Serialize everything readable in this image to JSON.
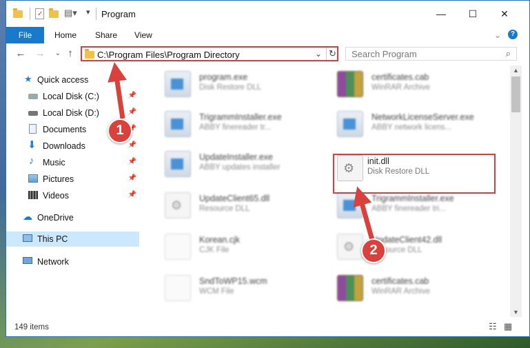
{
  "window": {
    "title": "Program"
  },
  "ribbon": {
    "tabs": [
      "File",
      "Home",
      "Share",
      "View"
    ]
  },
  "address": {
    "path": "C:\\Program Files\\Program Directory"
  },
  "search": {
    "placeholder": "Search Program"
  },
  "sidebar": {
    "items": [
      {
        "label": "Quick access"
      },
      {
        "label": "Local Disk (C:)"
      },
      {
        "label": "Local Disk (D:)"
      },
      {
        "label": "Documents"
      },
      {
        "label": "Downloads"
      },
      {
        "label": "Music"
      },
      {
        "label": "Pictures"
      },
      {
        "label": "Videos"
      },
      {
        "label": "OneDrive"
      },
      {
        "label": "This PC"
      },
      {
        "label": "Network"
      }
    ]
  },
  "files": [
    {
      "name": "program.exe",
      "desc": "Disk Restore DLL"
    },
    {
      "name": "certificates.cab",
      "desc": "WinRAR Archive"
    },
    {
      "name": "TrigrammInstaller.exe",
      "desc": "ABBY finereader tr..."
    },
    {
      "name": "NetworkLicenseServer.exe",
      "desc": "ABBY network licens..."
    },
    {
      "name": "UpdateInstaller.exe",
      "desc": "ABBY updates installer"
    },
    {
      "name": "init.dll",
      "desc": "Disk Restore DLL"
    },
    {
      "name": "UpdateClient65.dll",
      "desc": "Resource DLL"
    },
    {
      "name": "TrigrammInstaller.exe",
      "desc": "ABBY finereader tri..."
    },
    {
      "name": "Korean.cjk",
      "desc": "CJK File"
    },
    {
      "name": "UpdateClient42.dll",
      "desc": "Resource DLL"
    },
    {
      "name": "SndToWP15.wcm",
      "desc": "WCM File"
    },
    {
      "name": "certificates.cab",
      "desc": "WinRAR Archive"
    }
  ],
  "status": {
    "count": "149 items"
  },
  "annotations": {
    "step1": "1",
    "step2": "2"
  },
  "colors": {
    "accent": "#1979ca",
    "highlight": "#e0393e",
    "selection": "#cce8ff"
  }
}
